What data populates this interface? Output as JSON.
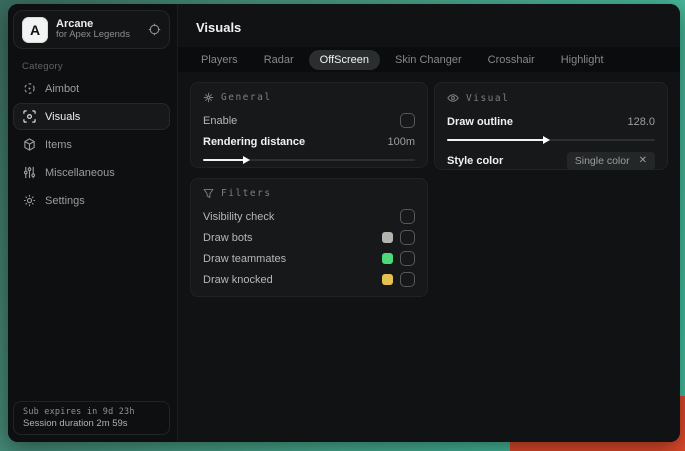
{
  "sidebar": {
    "logo_letter": "A",
    "app_name": "Arcane",
    "app_subtitle": "for Apex Legends",
    "category_label": "Category",
    "items": [
      {
        "label": "Aimbot",
        "icon": "crosshair-icon"
      },
      {
        "label": "Visuals",
        "icon": "eye-scan-icon",
        "selected": true
      },
      {
        "label": "Items",
        "icon": "cube-icon"
      },
      {
        "label": "Miscellaneous",
        "icon": "sliders-icon"
      },
      {
        "label": "Settings",
        "icon": "gear-icon"
      }
    ],
    "footer": {
      "sub_expires": "Sub expires in 9d 23h",
      "session_duration": "Session duration 2m 59s"
    }
  },
  "header": {
    "title": "Visuals"
  },
  "tabs": [
    {
      "label": "Players"
    },
    {
      "label": "Radar"
    },
    {
      "label": "OffScreen",
      "selected": true
    },
    {
      "label": "Skin Changer"
    },
    {
      "label": "Crosshair"
    },
    {
      "label": "Highlight"
    }
  ],
  "panels": {
    "general": {
      "title": "General",
      "icon": "sparkle-icon",
      "enable_label": "Enable",
      "enable_checked": false,
      "rendering_distance_label": "Rendering distance",
      "rendering_distance_value": "100m",
      "rendering_distance_fill": "20%"
    },
    "filters": {
      "title": "Filters",
      "icon": "funnel-icon",
      "rows": [
        {
          "label": "Visibility check",
          "checked": false
        },
        {
          "label": "Draw bots",
          "swatch": "#b3b4b0",
          "checked": false
        },
        {
          "label": "Draw teammates",
          "swatch": "#4cd97a",
          "checked": false
        },
        {
          "label": "Draw knocked",
          "swatch": "#e3c24f",
          "checked": false
        }
      ]
    },
    "visual": {
      "title": "Visual",
      "icon": "eye-icon",
      "draw_outline_label": "Draw outline",
      "draw_outline_value": "128.0",
      "draw_outline_fill": "47%",
      "style_color_label": "Style color",
      "style_color_value": "Single color",
      "clear_glyph": "✕"
    }
  },
  "colors": {
    "desktop_teal": "#49ad92",
    "desktop_orange": "#e04a2c",
    "window_bg": "#0e1011",
    "panel_bg": "#161819",
    "swatch_bots": "#b3b4b0",
    "swatch_teammates": "#4cd97a",
    "swatch_knocked": "#e3c24f"
  }
}
